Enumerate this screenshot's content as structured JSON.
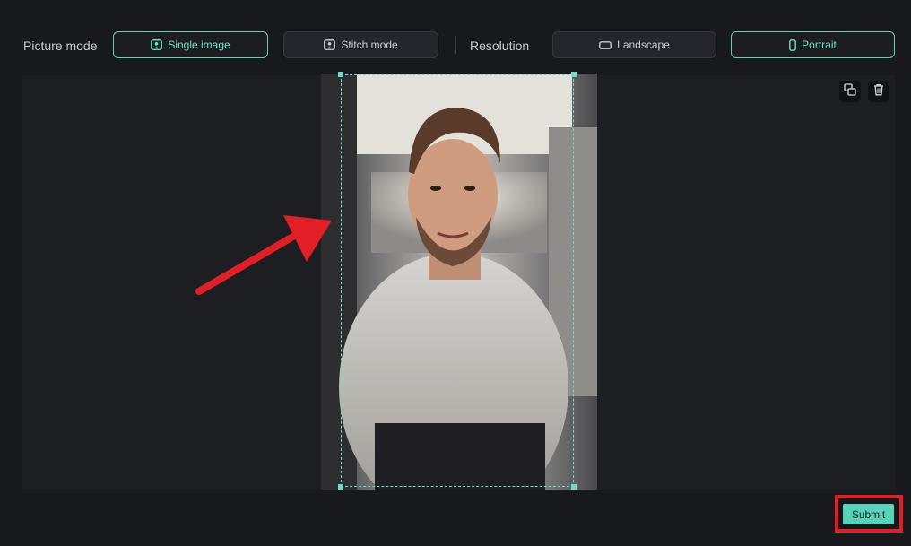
{
  "picture_mode": {
    "label": "Picture mode",
    "options": [
      {
        "label": "Single image",
        "selected": true,
        "icon": "image-person-icon"
      },
      {
        "label": "Stitch mode",
        "selected": false,
        "icon": "stitch-person-icon"
      }
    ]
  },
  "resolution": {
    "label": "Resolution",
    "options": [
      {
        "label": "Landscape",
        "selected": false,
        "icon": "landscape-rect-icon"
      },
      {
        "label": "Portrait",
        "selected": true,
        "icon": "portrait-rect-icon"
      }
    ]
  },
  "preview": {
    "image": "portrait-photo-man-smiling",
    "tools": [
      "replace-image-icon",
      "trash-icon"
    ]
  },
  "annotation": {
    "arrow_color": "#e21f26",
    "highlight_color": "#e21f26"
  },
  "submit_label": "Submit",
  "accent": "#5fd3b9"
}
